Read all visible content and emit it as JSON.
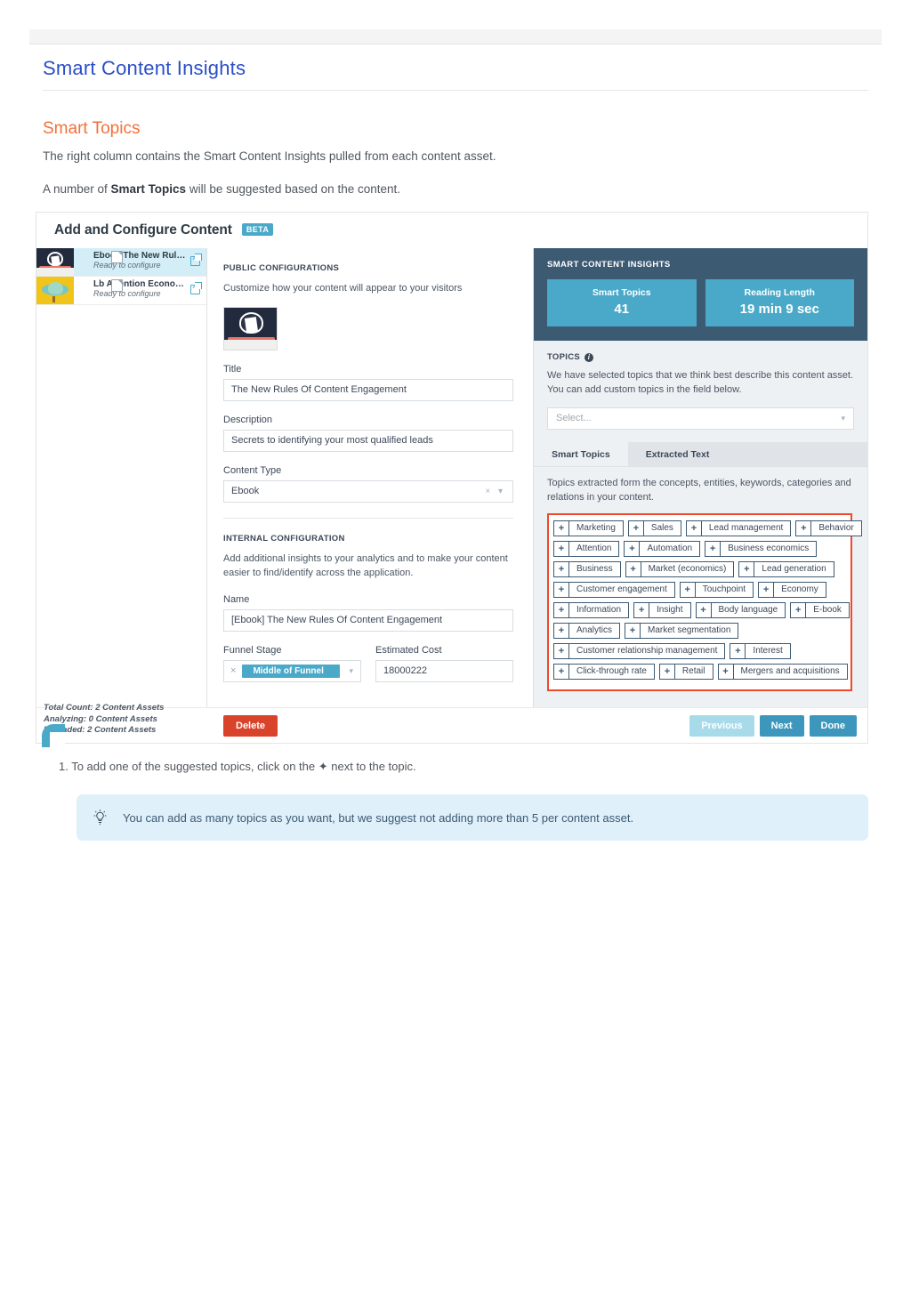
{
  "doc": {
    "page_title": "Smart Content Insights",
    "section_title": "Smart Topics",
    "para1": "The right column contains the Smart Content Insights pulled from each content asset.",
    "para2_pre": "A number of ",
    "para2_bold": "Smart Topics",
    "para2_post": " will be suggested based on the content.",
    "step1": "1. To add one of the suggested topics, click on the ✦ next to the topic.",
    "callout_icon": "lightbulb-icon",
    "callout_text": "You can add as many topics as you want, but we suggest not adding more than 5 per content asset.",
    "accent_blue": "#2b4ec8",
    "accent_orange": "#f2713c",
    "callout_bg": "#dff0fb"
  },
  "app": {
    "header": {
      "title": "Add and Configure Content",
      "badge": "BETA"
    },
    "assets": [
      {
        "name": "Ebook The New Rules ...",
        "status": "Ready to configure",
        "selected": true
      },
      {
        "name": "Lb Attention Economy...",
        "status": "Ready to configure",
        "selected": false
      }
    ],
    "public_config": {
      "section_label": "PUBLIC CONFIGURATIONS",
      "description": "Customize how your content will appear to your visitors",
      "fields": [
        {
          "label": "Title",
          "value": "The New Rules Of Content Engagement",
          "type": "text"
        },
        {
          "label": "Description",
          "value": "Secrets to identifying your most qualified leads",
          "type": "text"
        },
        {
          "label": "Content Type",
          "value": "Ebook",
          "type": "select",
          "controls": "× ▾"
        }
      ]
    },
    "internal_config": {
      "section_label": "INTERNAL CONFIGURATION",
      "description": "Add additional insights to your analytics and to make your content easier to find/identify across the application.",
      "name_label": "Name",
      "name_value": "[Ebook] The New Rules Of Content Engagement",
      "funnel_label": "Funnel Stage",
      "funnel_chip": "Middle of Funnel",
      "funnel_clear": "×",
      "funnel_caret": "▾",
      "cost_label": "Estimated Cost",
      "cost_value": "18000222"
    },
    "insights": {
      "title": "SMART CONTENT INSIGHTS",
      "cards": [
        {
          "key": "Smart Topics",
          "value": "41"
        },
        {
          "key": "Reading Length",
          "value": "19 min 9 sec"
        }
      ],
      "topics_label": "TOPICS",
      "info_glyph": "i",
      "topics_desc": "We have selected topics that we think best describe this content asset. You can add custom topics in the field below.",
      "select_placeholder": "Select...",
      "select_caret": "▾",
      "tabs": [
        {
          "label": "Smart Topics",
          "active": true
        },
        {
          "label": "Extracted Text",
          "active": false
        }
      ],
      "tab_desc": "Topics extracted form the concepts, entities, keywords, categories and relations in your content.",
      "highlight_color": "#f0492b",
      "topic_rows": [
        [
          "Marketing",
          "Sales",
          "Lead management",
          "Behavior"
        ],
        [
          "Attention",
          "Automation",
          "Business economics"
        ],
        [
          "Business",
          "Market (economics)",
          "Lead generation"
        ],
        [
          "Customer engagement",
          "Touchpoint",
          "Economy"
        ],
        [
          "Information",
          "Insight",
          "Body language",
          "E-book"
        ],
        [
          "Analytics",
          "Market segmentation"
        ],
        [
          "Customer relationship management",
          "Interest"
        ],
        [
          "Click-through rate",
          "Retail",
          "Mergers and acquisitions"
        ]
      ],
      "add_glyph": "+"
    },
    "footer": {
      "counts": [
        "Total Count: 2 Content Assets",
        "Analyzing: 0 Content Assets",
        "Uploaded: 2 Content Assets"
      ],
      "delete_label": "Delete",
      "previous_label": "Previous",
      "next_label": "Next",
      "done_label": "Done"
    },
    "colors": {
      "teal": "#4aa9c9",
      "dark_slate": "#3d5a73",
      "delete_red": "#d9422b"
    }
  }
}
